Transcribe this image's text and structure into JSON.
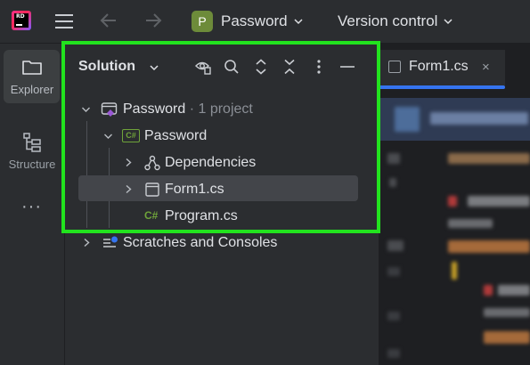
{
  "topbar": {
    "project_badge": "P",
    "project_name": "Password",
    "vcs_label": "Version control",
    "logo_text": "RD"
  },
  "toolstrip": {
    "explorer_label": "Explorer",
    "structure_label": "Structure",
    "more_label": "···"
  },
  "solution": {
    "title": "Solution",
    "tree": [
      {
        "label": "Password",
        "suffix": " · 1 project",
        "icon": "solution-icon"
      },
      {
        "label": "Password",
        "icon": "csharp-project-icon",
        "icon_text": "C#"
      },
      {
        "label": "Dependencies",
        "icon": "dependencies-icon"
      },
      {
        "label": "Form1.cs",
        "icon": "form-icon"
      },
      {
        "label": "Program.cs",
        "icon": "csharp-file-icon",
        "icon_text": "C#"
      },
      {
        "label": "Scratches and Consoles",
        "icon": "scratches-icon"
      }
    ]
  },
  "editor": {
    "tab_label": "Form1.cs",
    "tab_close": "×"
  },
  "colors": {
    "highlight": "#22e31e",
    "accent": "#3574f0",
    "project_badge": "#6d8b3a"
  }
}
